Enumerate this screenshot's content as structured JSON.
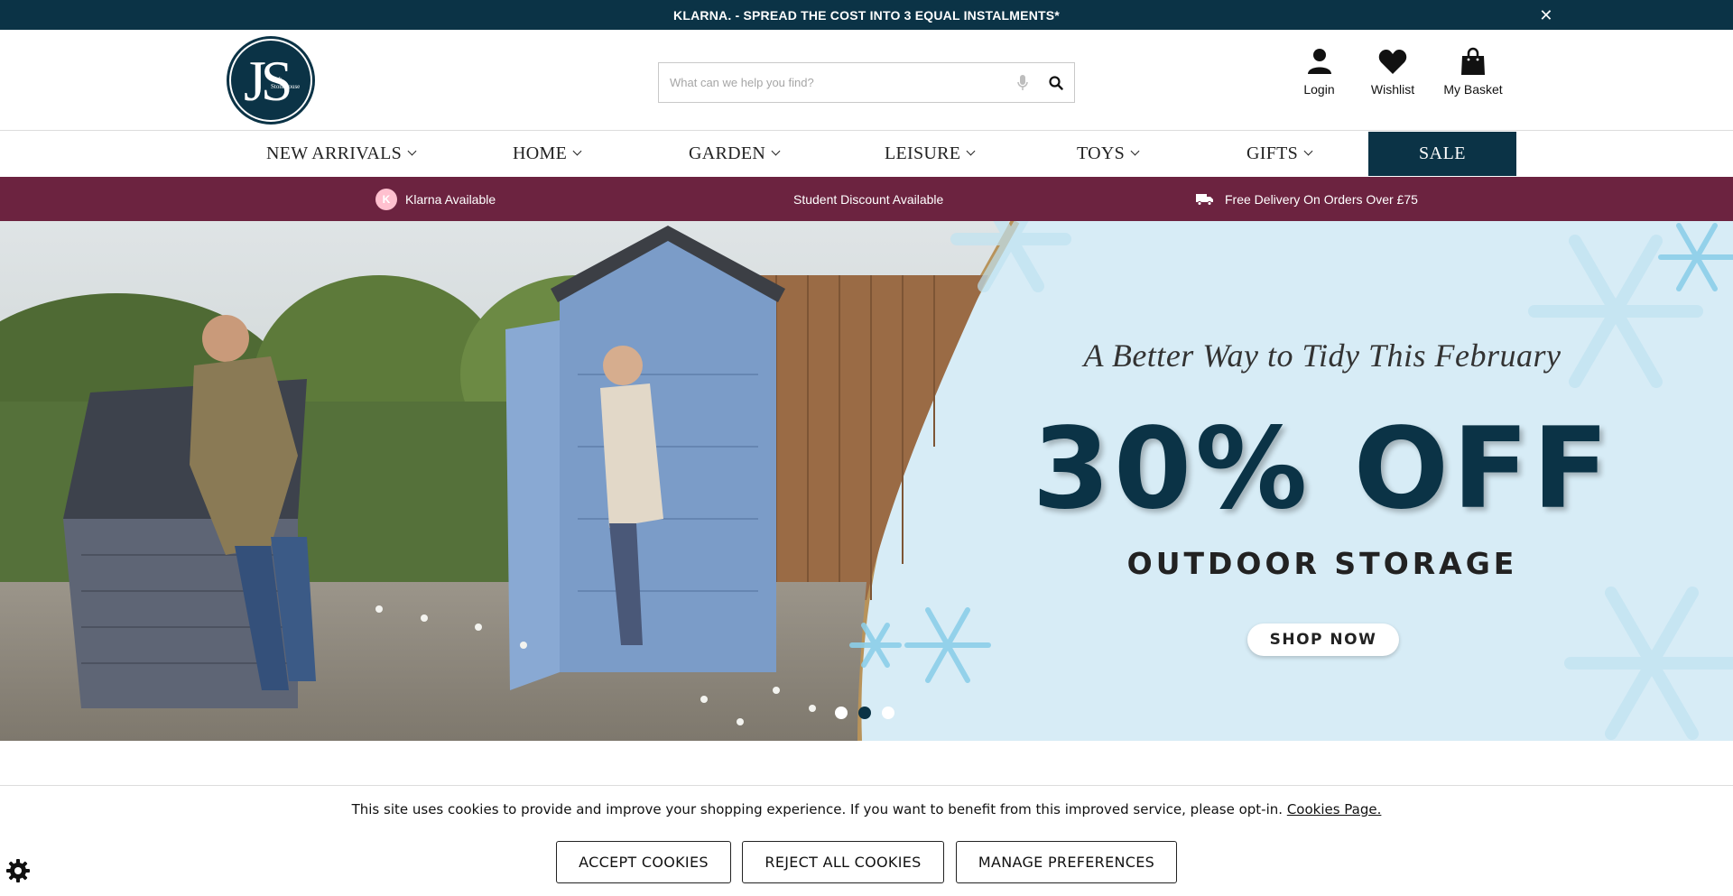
{
  "announcement": {
    "text": "KLARNA. - SPREAD THE COST INTO 3 EQUAL INSTALMENTS*",
    "close_icon": "close-icon"
  },
  "header": {
    "logo_letters": "JS",
    "logo_small": "Jack Stonehouse",
    "search": {
      "placeholder": "What can we help you find?",
      "value": ""
    },
    "links": {
      "login": "Login",
      "wishlist": "Wishlist",
      "basket": "My Basket"
    }
  },
  "nav": {
    "items": [
      "NEW ARRIVALS",
      "HOME",
      "GARDEN",
      "LEISURE",
      "TOYS",
      "GIFTS"
    ],
    "sale": "SALE"
  },
  "usp": {
    "klarna_k": "K",
    "klarna": "Klarna Available",
    "student": "Student Discount Available",
    "delivery": "Free Delivery On Orders Over £75"
  },
  "hero": {
    "tagline": "A Better Way to Tidy This February",
    "headline": "30% OFF",
    "subheadline": "OUTDOOR STORAGE",
    "cta": "SHOP NOW",
    "slides": 3,
    "active_slide": 2
  },
  "cookie": {
    "text": "This site uses cookies to provide and improve your shopping experience. If you want to benefit from this improved service, please opt-in.",
    "link": "Cookies Page.",
    "accept": "ACCEPT COOKIES",
    "reject": "REJECT ALL COOKIES",
    "manage": "MANAGE PREFERENCES"
  },
  "colors": {
    "brand": "#0b3346",
    "usp_bar": "#6c2340",
    "hero_bg": "#d7ecf6"
  }
}
